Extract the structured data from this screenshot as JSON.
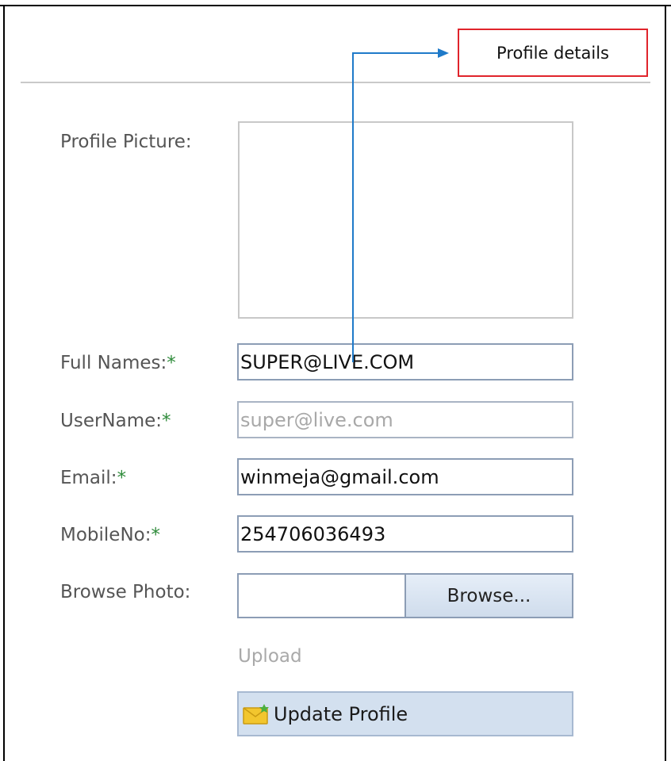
{
  "callout": {
    "label": "Profile details"
  },
  "form": {
    "profile_picture_label": "Profile Picture:",
    "full_names_label": "Full Names:",
    "full_names_value": "SUPER@LIVE.COM",
    "username_label": "UserName:",
    "username_value": "super@live.com",
    "email_label": "Email:",
    "email_value": "winmeja@gmail.com",
    "mobile_label": "MobileNo:",
    "mobile_value": "254706036493",
    "browse_photo_label": "Browse Photo:",
    "browse_button_label": "Browse...",
    "upload_link": "Upload",
    "update_button_label": "Update Profile",
    "required_marker": "*"
  },
  "colors": {
    "callout_border": "#e0242b",
    "arrow": "#1f7ac9",
    "required_marker": "#2e8b3a",
    "button_fill": "#d3e0ef"
  },
  "icons": {
    "update_button_icon": "envelope-icon"
  }
}
